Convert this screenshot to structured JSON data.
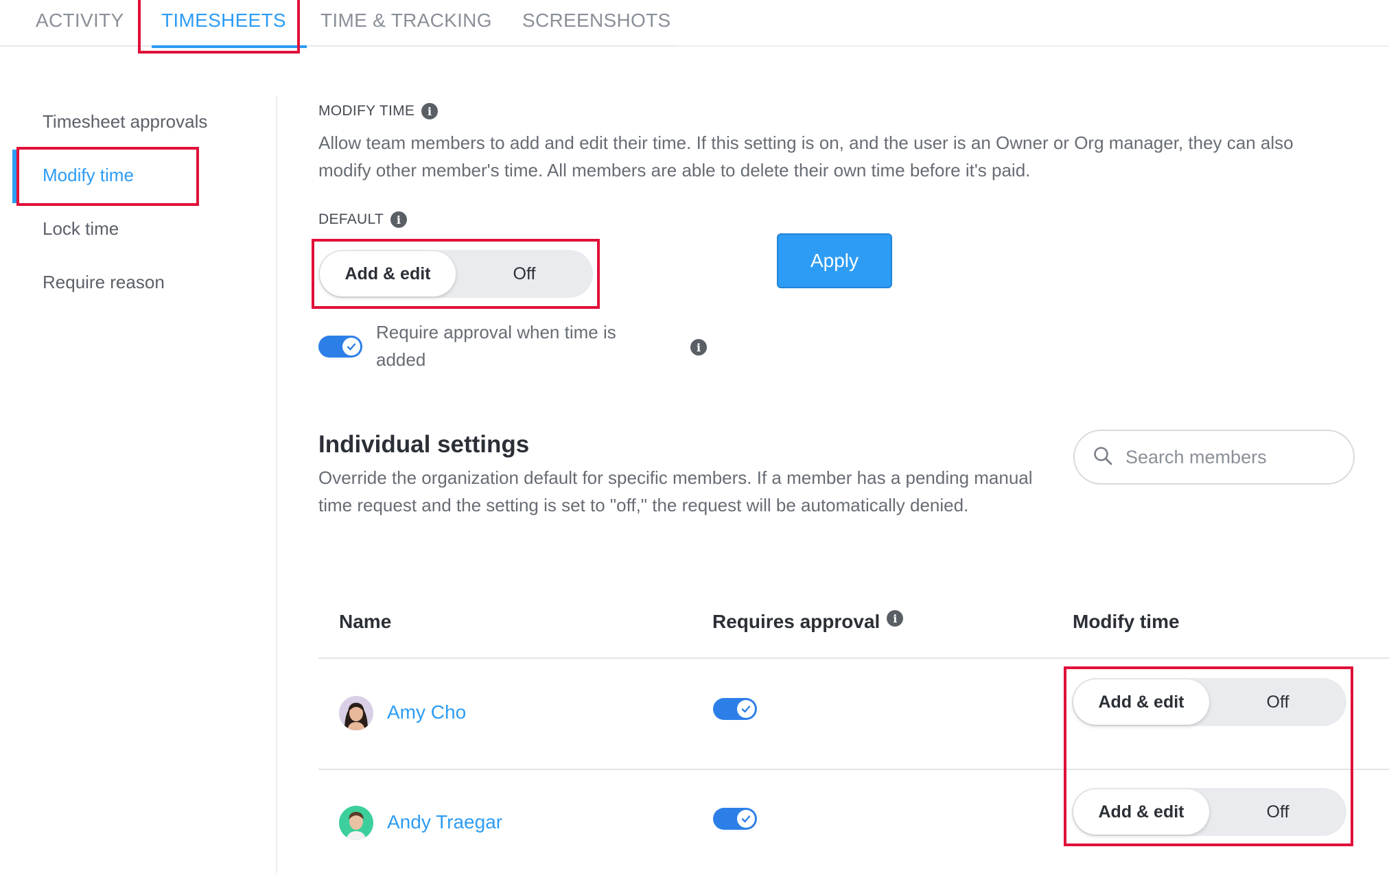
{
  "tabs": [
    {
      "label": "ACTIVITY"
    },
    {
      "label": "TIMESHEETS"
    },
    {
      "label": "TIME & TRACKING"
    },
    {
      "label": "SCREENSHOTS"
    }
  ],
  "sidebar": {
    "items": [
      {
        "label": "Timesheet approvals"
      },
      {
        "label": "Modify time"
      },
      {
        "label": "Lock time"
      },
      {
        "label": "Require reason"
      }
    ]
  },
  "modify_time": {
    "heading": "MODIFY TIME",
    "description": "Allow team members to add and edit their time. If this setting is on, and the user is an Owner or Org manager, they can also modify other member's time. All members are able to delete their own time before it's paid.",
    "default_label": "DEFAULT",
    "option_on": "Add & edit",
    "option_off": "Off",
    "apply_label": "Apply",
    "require_approval_text": "Require approval when time is added"
  },
  "individual": {
    "title": "Individual settings",
    "description": "Override the organization default for specific members. If a member has a pending manual time request and the setting is set to \"off,\" the request will be automatically denied.",
    "search_placeholder": "Search members",
    "columns": {
      "name": "Name",
      "approval": "Requires approval",
      "modify": "Modify time"
    },
    "rows": [
      {
        "name": "Amy Cho",
        "option_on": "Add & edit",
        "option_off": "Off"
      },
      {
        "name": "Andy Traegar",
        "option_on": "Add & edit",
        "option_off": "Off"
      }
    ]
  },
  "colors": {
    "accent": "#2d9cf4",
    "toggle": "#2d7fe8",
    "highlight": "#e0103a"
  }
}
